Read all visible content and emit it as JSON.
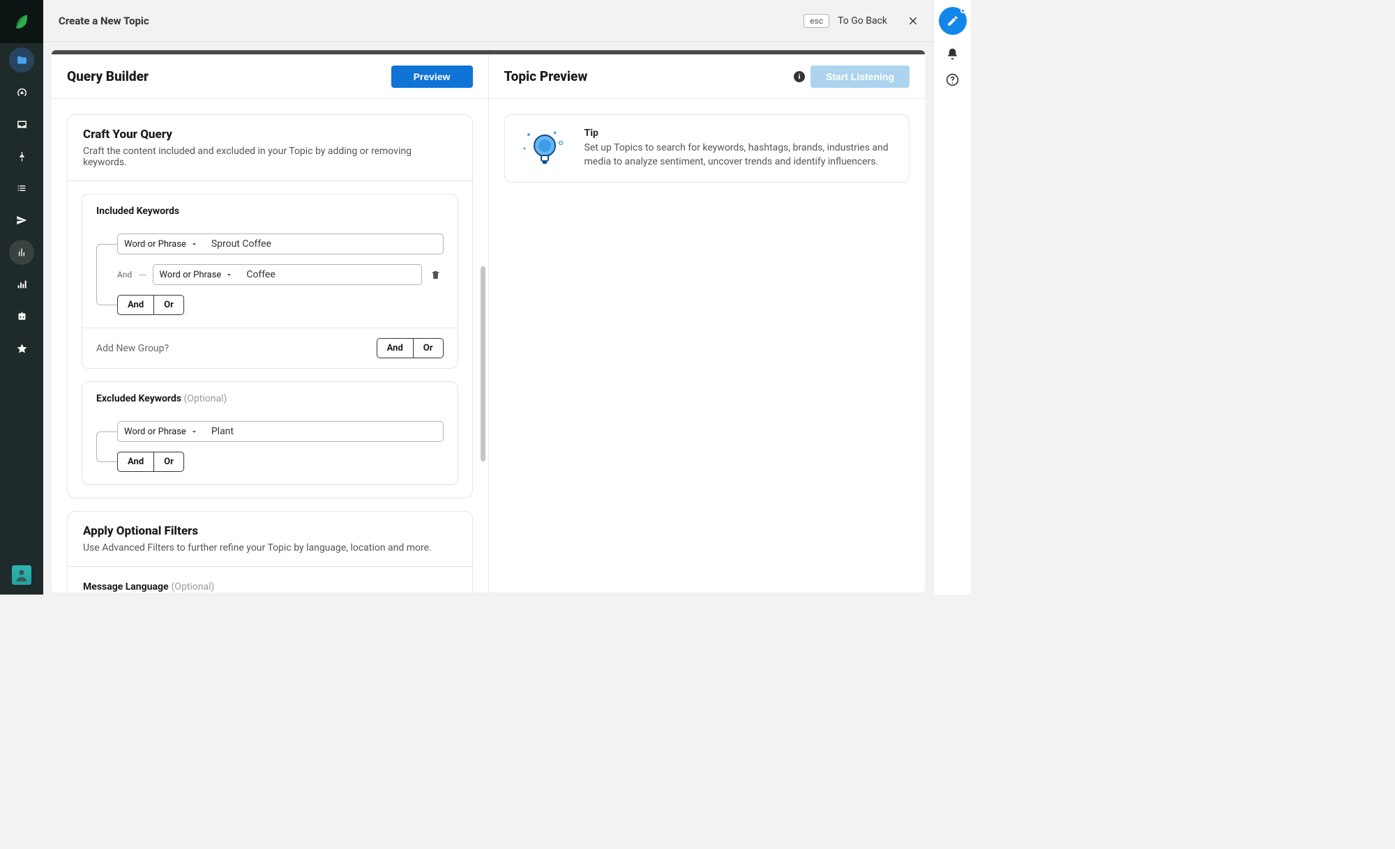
{
  "topbar": {
    "title": "Create a New Topic",
    "esc_label": "esc",
    "go_back": "To Go Back"
  },
  "left": {
    "title": "Query Builder",
    "preview_btn": "Preview",
    "craft": {
      "title": "Craft Your Query",
      "subtitle": "Craft the content included and excluded in your Topic by adding or removing keywords."
    },
    "included": {
      "heading": "Included Keywords",
      "rows": [
        {
          "type_label": "Word or Phrase",
          "value": "Sprout Coffee"
        },
        {
          "join_label": "And",
          "type_label": "Word or Phrase",
          "value": "Coffee"
        }
      ],
      "and": "And",
      "or": "Or",
      "add_group": "Add New Group?",
      "group_and": "And",
      "group_or": "Or"
    },
    "excluded": {
      "heading": "Excluded Keywords",
      "optional": "(Optional)",
      "rows": [
        {
          "type_label": "Word or Phrase",
          "value": "Plant"
        }
      ],
      "and": "And",
      "or": "Or"
    },
    "filters": {
      "title": "Apply Optional Filters",
      "subtitle": "Use Advanced Filters to further refine your Topic by language, location and more.",
      "language_heading": "Message Language",
      "language_optional": "(Optional)"
    }
  },
  "right": {
    "title": "Topic Preview",
    "listen_btn": "Start Listening",
    "tip": {
      "title": "Tip",
      "body": "Set up Topics to search for keywords, hashtags, brands, industries and media to analyze sentiment, uncover trends and identify influencers."
    }
  }
}
